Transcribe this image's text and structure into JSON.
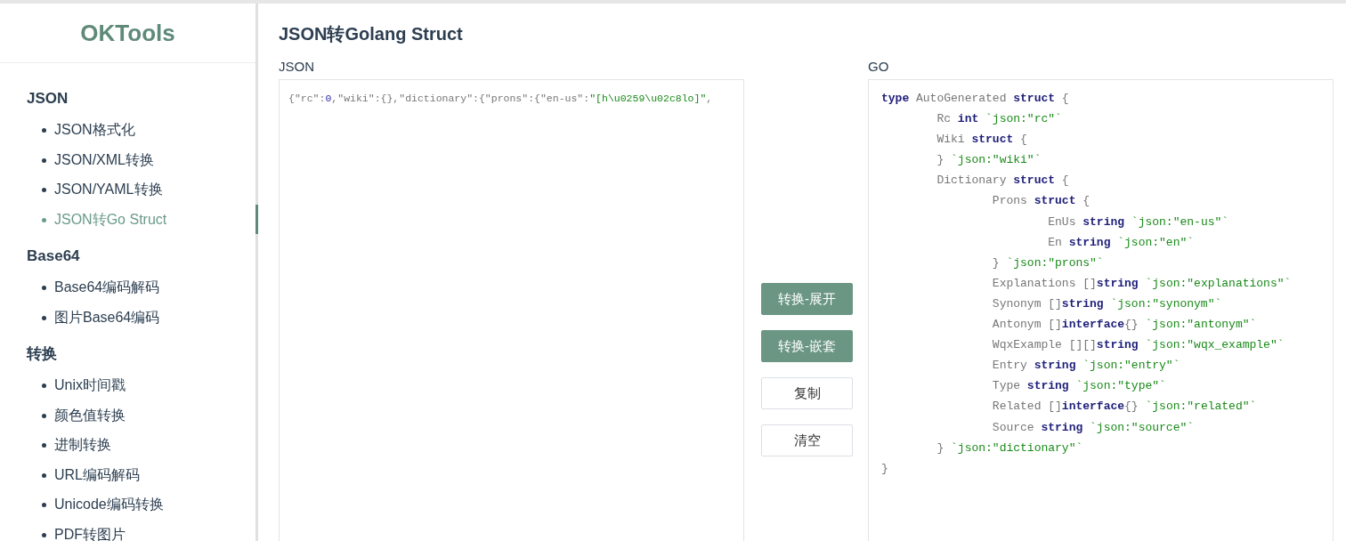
{
  "logo": "OKTools",
  "sidebar": {
    "groups": [
      {
        "title": "JSON",
        "items": [
          {
            "label": "JSON格式化",
            "selected": false
          },
          {
            "label": "JSON/XML转换",
            "selected": false
          },
          {
            "label": "JSON/YAML转换",
            "selected": false
          },
          {
            "label": "JSON转Go Struct",
            "selected": true
          }
        ]
      },
      {
        "title": "Base64",
        "items": [
          {
            "label": "Base64编码解码",
            "selected": false
          },
          {
            "label": "图片Base64编码",
            "selected": false
          }
        ]
      },
      {
        "title": "转换",
        "items": [
          {
            "label": "Unix时间戳",
            "selected": false
          },
          {
            "label": "颜色值转换",
            "selected": false
          },
          {
            "label": "进制转换",
            "selected": false
          },
          {
            "label": "URL编码解码",
            "selected": false
          },
          {
            "label": "Unicode编码转换",
            "selected": false
          },
          {
            "label": "PDF转图片",
            "selected": false
          }
        ]
      }
    ]
  },
  "page_title": "JSON转Golang Struct",
  "json_panel": {
    "label": "JSON",
    "value": [
      {
        "kind": "plain",
        "text": "{\"rc\":"
      },
      {
        "kind": "number",
        "text": "0"
      },
      {
        "kind": "plain",
        "text": ",\"wiki\":{},\"dictionary\":{\"prons\":{\"en-us\":"
      },
      {
        "kind": "string",
        "text": "\"[h\\u0259\\u02c8lo]\""
      },
      {
        "kind": "plain",
        "text": ","
      }
    ]
  },
  "buttons": [
    {
      "label": "转换-展开",
      "kind": "primary"
    },
    {
      "label": "转换-嵌套",
      "kind": "primary"
    },
    {
      "label": "复制",
      "kind": "default"
    },
    {
      "label": "清空",
      "kind": "default"
    }
  ],
  "go_panel": {
    "label": "GO",
    "lines": [
      [
        {
          "kind": "keyword",
          "text": "type"
        },
        {
          "kind": "plain",
          "text": " AutoGenerated "
        },
        {
          "kind": "keyword",
          "text": "struct"
        },
        {
          "kind": "plain",
          "text": " {"
        }
      ],
      [
        {
          "kind": "plain",
          "text": "\tRc "
        },
        {
          "kind": "keyword",
          "text": "int"
        },
        {
          "kind": "tag",
          "text": " `json:\"rc\"`"
        }
      ],
      [
        {
          "kind": "plain",
          "text": "\tWiki "
        },
        {
          "kind": "keyword",
          "text": "struct"
        },
        {
          "kind": "plain",
          "text": " {"
        }
      ],
      [
        {
          "kind": "plain",
          "text": "\t}"
        },
        {
          "kind": "tag",
          "text": " `json:\"wiki\"`"
        }
      ],
      [
        {
          "kind": "plain",
          "text": "\tDictionary "
        },
        {
          "kind": "keyword",
          "text": "struct"
        },
        {
          "kind": "plain",
          "text": " {"
        }
      ],
      [
        {
          "kind": "plain",
          "text": "\t\tProns "
        },
        {
          "kind": "keyword",
          "text": "struct"
        },
        {
          "kind": "plain",
          "text": " {"
        }
      ],
      [
        {
          "kind": "plain",
          "text": "\t\t\tEnUs "
        },
        {
          "kind": "keyword",
          "text": "string"
        },
        {
          "kind": "tag",
          "text": " `json:\"en-us\"`"
        }
      ],
      [
        {
          "kind": "plain",
          "text": "\t\t\tEn "
        },
        {
          "kind": "keyword",
          "text": "string"
        },
        {
          "kind": "tag",
          "text": " `json:\"en\"`"
        }
      ],
      [
        {
          "kind": "plain",
          "text": "\t\t}"
        },
        {
          "kind": "tag",
          "text": " `json:\"prons\"`"
        }
      ],
      [
        {
          "kind": "plain",
          "text": "\t\tExplanations []"
        },
        {
          "kind": "keyword",
          "text": "string"
        },
        {
          "kind": "tag",
          "text": " `json:\"explanations\"`"
        }
      ],
      [
        {
          "kind": "plain",
          "text": "\t\tSynonym []"
        },
        {
          "kind": "keyword",
          "text": "string"
        },
        {
          "kind": "tag",
          "text": " `json:\"synonym\"`"
        }
      ],
      [
        {
          "kind": "plain",
          "text": "\t\tAntonym []"
        },
        {
          "kind": "keyword",
          "text": "interface"
        },
        {
          "kind": "plain",
          "text": "{}"
        },
        {
          "kind": "tag",
          "text": " `json:\"antonym\"`"
        }
      ],
      [
        {
          "kind": "plain",
          "text": "\t\tWqxExample [][]"
        },
        {
          "kind": "keyword",
          "text": "string"
        },
        {
          "kind": "tag",
          "text": " `json:\"wqx_example\"`"
        }
      ],
      [
        {
          "kind": "plain",
          "text": "\t\tEntry "
        },
        {
          "kind": "keyword",
          "text": "string"
        },
        {
          "kind": "tag",
          "text": " `json:\"entry\"`"
        }
      ],
      [
        {
          "kind": "plain",
          "text": "\t\tType "
        },
        {
          "kind": "keyword",
          "text": "string"
        },
        {
          "kind": "tag",
          "text": " `json:\"type\"`"
        }
      ],
      [
        {
          "kind": "plain",
          "text": "\t\tRelated []"
        },
        {
          "kind": "keyword",
          "text": "interface"
        },
        {
          "kind": "plain",
          "text": "{}"
        },
        {
          "kind": "tag",
          "text": " `json:\"related\"`"
        }
      ],
      [
        {
          "kind": "plain",
          "text": "\t\tSource "
        },
        {
          "kind": "keyword",
          "text": "string"
        },
        {
          "kind": "tag",
          "text": " `json:\"source\"`"
        }
      ],
      [
        {
          "kind": "plain",
          "text": "\t}"
        },
        {
          "kind": "tag",
          "text": " `json:\"dictionary\"`"
        }
      ],
      [
        {
          "kind": "plain",
          "text": "}"
        }
      ]
    ]
  }
}
